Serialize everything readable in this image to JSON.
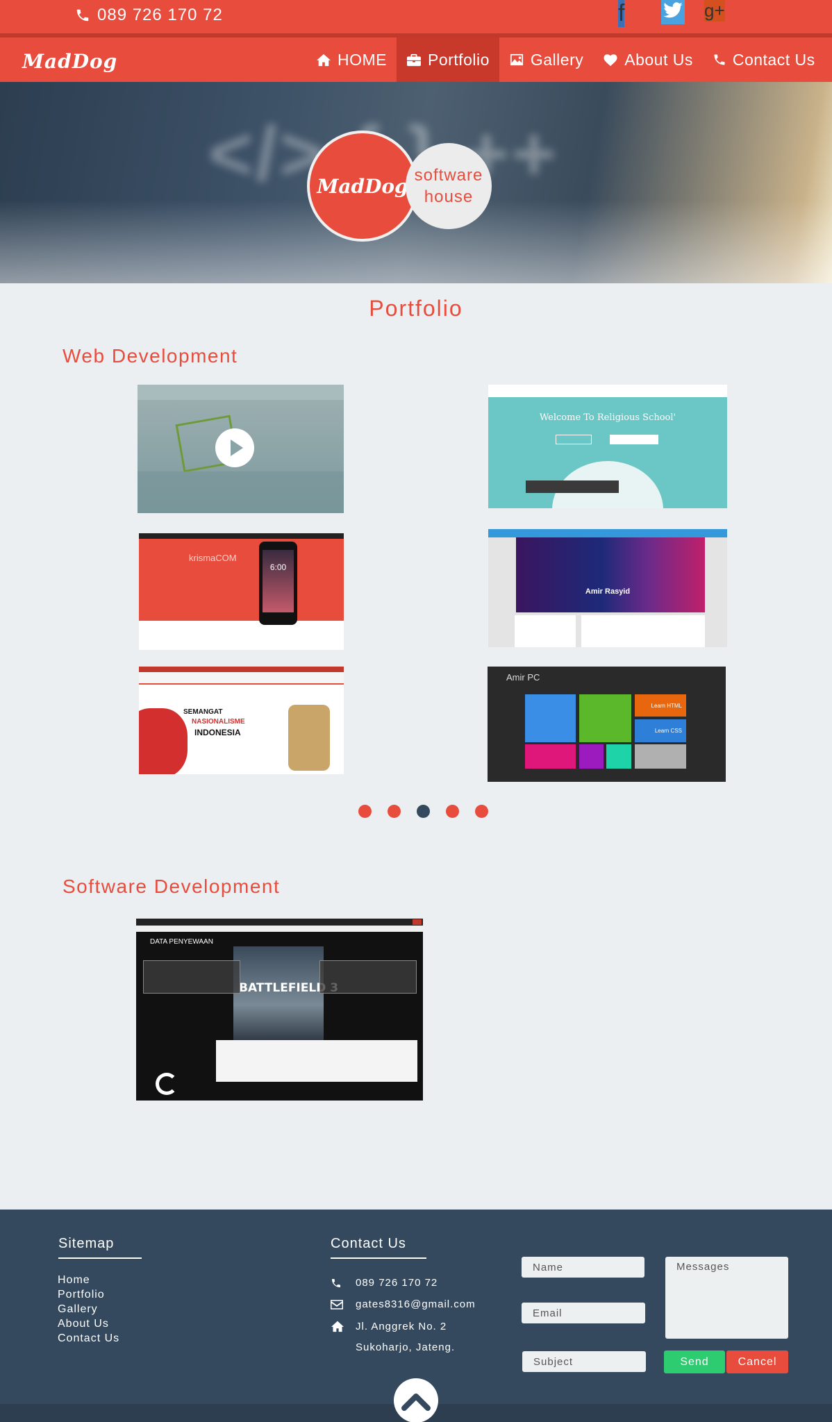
{
  "topbar": {
    "phone": "089 726 170 72"
  },
  "social": {
    "facebook": "f",
    "twitter": "twitter-icon",
    "googleplus": "g+"
  },
  "brand": {
    "logo": "MadDog"
  },
  "nav": {
    "items": [
      {
        "label": "HOME",
        "icon": "home-icon"
      },
      {
        "label": "Portfolio",
        "icon": "briefcase-icon",
        "active": true
      },
      {
        "label": "Gallery",
        "icon": "image-icon"
      },
      {
        "label": "About Us",
        "icon": "heart-icon"
      },
      {
        "label": "Contact Us",
        "icon": "phone-icon"
      }
    ]
  },
  "hero": {
    "badge_logo": "MadDog",
    "badge_line1": "software",
    "badge_line2": "house"
  },
  "main": {
    "title": "Portfolio",
    "web_section": "Web Development",
    "software_section": "Software Development"
  },
  "thumbs": {
    "t2_heading": "Welcome To Religious School'",
    "t3_brand": "krismaCOM",
    "t3_time": "6:00",
    "t4_name": "Amir Rasyid",
    "t5_text1": "SEMANGAT",
    "t5_text2": "NASIONALISME",
    "t5_text3": "INDONESIA",
    "t6_title": "Amir PC",
    "t6_tile1": "Learn HTML",
    "t6_tile2": "Learn CSS",
    "soft_title": "DATA PENYEWAAN",
    "soft_game": "BATTLEFIELD 3"
  },
  "carousel": {
    "count": 5,
    "active": 3
  },
  "footer": {
    "sitemap_title": "Sitemap",
    "sitemap": [
      "Home",
      "Portfolio",
      "Gallery",
      "About Us",
      "Contact Us"
    ],
    "contact_title": "Contact Us",
    "phone": "089 726 170 72",
    "email": "gates8316@gmail.com",
    "address1": "Jl. Anggrek No. 2",
    "address2": "Sukoharjo, Jateng.",
    "form": {
      "name_placeholder": "Name",
      "email_placeholder": "Email",
      "subject_placeholder": "Subject",
      "messages_placeholder": "Messages",
      "send": "Send",
      "cancel": "Cancel"
    }
  },
  "colors": {
    "accent": "#e74c3c",
    "dark": "#34495e",
    "send": "#2ecc71"
  }
}
